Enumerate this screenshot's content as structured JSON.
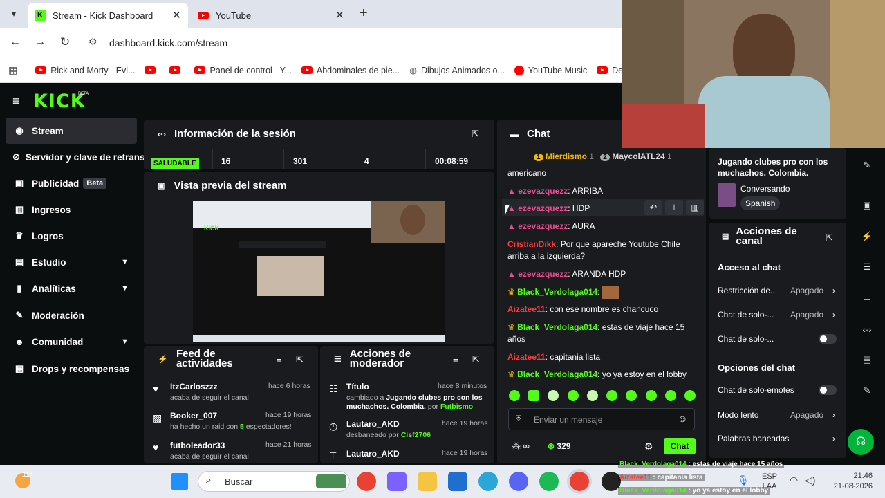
{
  "browser": {
    "tabs": [
      {
        "title": "Stream - Kick Dashboard"
      },
      {
        "title": "YouTube"
      }
    ],
    "url": "dashboard.kick.com/stream",
    "bookmarks": [
      "Rick and Morty - Evi...",
      "Panel de control - Y...",
      "Abdominales de pie...",
      "Dibujos Animados o...",
      "YouTube Music",
      "Des"
    ]
  },
  "app": {
    "logo": "KICK",
    "logo_badge": "BETA",
    "sidebar": [
      {
        "label": "Stream",
        "icon": "broadcast-icon"
      },
      {
        "label": "Servidor y clave de retrans",
        "icon": "link-icon"
      },
      {
        "label": "Publicidad",
        "badge": "Beta",
        "icon": "ad-icon"
      },
      {
        "label": "Ingresos",
        "icon": "money-icon"
      },
      {
        "label": "Logros",
        "icon": "trophy-icon"
      },
      {
        "label": "Estudio",
        "icon": "studio-icon"
      },
      {
        "label": "Analíticas",
        "icon": "chart-icon"
      },
      {
        "label": "Moderación",
        "icon": "wrench-icon"
      },
      {
        "label": "Comunidad",
        "icon": "community-icon"
      },
      {
        "label": "Drops y recompensas",
        "icon": "gift-icon"
      }
    ],
    "session": {
      "title": "Información de la sesión",
      "health": "SALUDABLE",
      "stats": [
        "16",
        "301",
        "4",
        "00:08:59"
      ]
    },
    "preview": {
      "title": "Vista previa del stream"
    },
    "feed": {
      "title": "Feed de actividades",
      "items": [
        {
          "user": "ItzCarloszzz",
          "time": "hace 6 horas",
          "text": "acaba de seguir el canal"
        },
        {
          "user": "Booker_007",
          "time": "hace 19 horas",
          "text_a": "ha hecho un raid con",
          "count": "5",
          "text_b": "espectadores!"
        },
        {
          "user": "futboleador33",
          "time": "hace 21 horas",
          "text": "acaba de seguir el canal"
        }
      ]
    },
    "mod": {
      "title": "Acciones de moderador",
      "items": [
        {
          "user": "Título",
          "time": "hace 8 minutos",
          "a": "cambiado a",
          "b": "Jugando clubes pro con los muchachos. Colombia.",
          "c": "por",
          "d": "Futbismo"
        },
        {
          "user": "Lautaro_AKD",
          "time": "hace 19 horas",
          "a": "desbaneado por",
          "d": "Cisf2706"
        },
        {
          "user": "Lautaro_AKD",
          "time": "hace 19 horas"
        }
      ]
    },
    "chat": {
      "title": "Chat",
      "top": [
        {
          "rank": "1",
          "name": "Mierdismo",
          "n": "1"
        },
        {
          "rank": "2",
          "name": "MaycolATL24",
          "n": "1"
        }
      ],
      "messages": [
        {
          "user": "",
          "text": "americano"
        },
        {
          "user": "ezevazquezz",
          "text": "ARRIBA"
        },
        {
          "user": "ezevazquezz",
          "text": "HDP"
        },
        {
          "user": "ezevazquezz",
          "text": "AURA"
        },
        {
          "user": "CristianDikk",
          "text": "Por que apareche Youtube Chile arriba a la izquierda?"
        },
        {
          "user": "ezevazquezz",
          "text": "ARANDA HDP"
        },
        {
          "user": "Black_Verdolaga014",
          "text": ""
        },
        {
          "user": "Aizatee11",
          "text": "con ese nombre es chancuco"
        },
        {
          "user": "Black_Verdolaga014",
          "text": "estas de viaje hace 15 años"
        },
        {
          "user": "Aizatee11",
          "text": "capitania lista"
        },
        {
          "user": "Black_Verdolaga014",
          "text": "yo ya estoy en el lobby"
        }
      ],
      "input_placeholder": "Enviar un mensaje",
      "viewers": "329",
      "send": "Chat"
    },
    "info": {
      "title": "Jugando clubes pro con los muchachos. Colombia.",
      "category": "Conversando",
      "language": "Spanish"
    },
    "actions": {
      "title": "Acciones de canal",
      "sec1": "Acceso al chat",
      "r1": {
        "label": "Restricción de...",
        "value": "Apagado"
      },
      "r2": {
        "label": "Chat de solo-...",
        "value": "Apagado"
      },
      "r3": {
        "label": "Chat de solo-..."
      },
      "sec2": "Opciones del chat",
      "r4": {
        "label": "Chat de solo-emotes"
      },
      "r5": {
        "label": "Modo lento",
        "value": "Apagado"
      },
      "r6": {
        "label": "Palabras baneadas"
      }
    }
  },
  "taskbar": {
    "weather": "11°",
    "search": "Buscar",
    "lang": "ESP",
    "lang2": "LAA",
    "time": "21:46",
    "date": "21-08-2026",
    "overlay": [
      {
        "user": "Black_Verdolaga014",
        "text": "estas de viaje hace 15 años"
      },
      {
        "user": "Aizatee11",
        "text": "capitania lista"
      },
      {
        "user": "Black_Verdolaga014",
        "text": "yo ya estoy en el lobby"
      }
    ]
  }
}
